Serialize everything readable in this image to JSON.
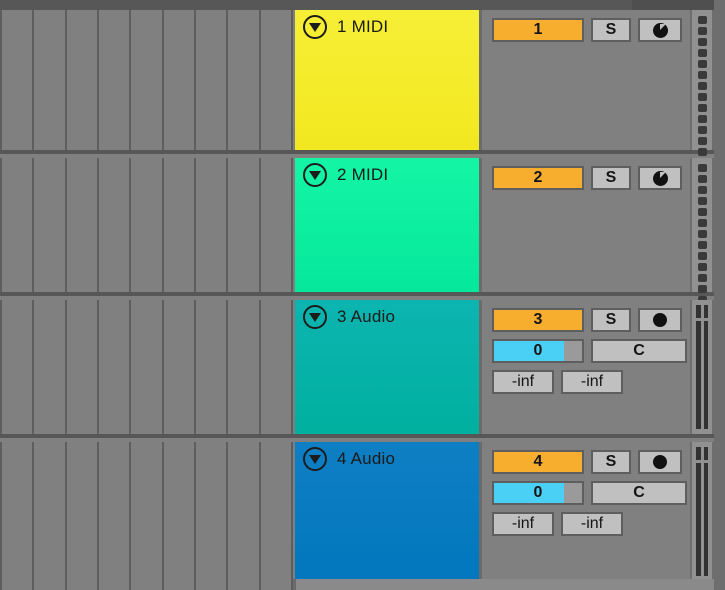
{
  "app": {
    "view": "session-view",
    "grid_columns": 9
  },
  "colors": {
    "background": "#808080",
    "divider": "#575757",
    "accent_orange": "#f7ad2e",
    "accent_cyan": "#4ad0f5",
    "button_face": "#c0c0c0",
    "text_dark": "#141414"
  },
  "tracks": [
    {
      "index": "1",
      "name": "1 MIDI",
      "type": "midi",
      "color_top": "#f7ef36",
      "color_bottom": "#f2e820",
      "disclosure_icon": "triangle-down-icon",
      "controls": {
        "track_number_label": "1",
        "solo_label": "S",
        "arm_icon": "midi-record-arm-icon",
        "arm_label": ""
      },
      "meter": {
        "style": "dots",
        "dot_count": 15
      }
    },
    {
      "index": "2",
      "name": "2 MIDI",
      "type": "midi",
      "color_top": "#15f5a6",
      "color_bottom": "#05e79b",
      "disclosure_icon": "triangle-down-icon",
      "controls": {
        "track_number_label": "2",
        "solo_label": "S",
        "arm_icon": "midi-record-arm-icon",
        "arm_label": ""
      },
      "meter": {
        "style": "dots",
        "dot_count": 15
      }
    },
    {
      "index": "3",
      "name": "3 Audio",
      "type": "audio",
      "color_top": "#0cb5b0",
      "color_bottom": "#01b09f",
      "disclosure_icon": "triangle-down-icon",
      "controls": {
        "track_number_label": "3",
        "solo_label": "S",
        "arm_icon": "audio-record-arm-icon",
        "volume_value": "0",
        "volume_fill_percent": 80,
        "pan_label": "C",
        "meter_left_label": "-inf",
        "meter_right_label": "-inf"
      },
      "meter": {
        "style": "bars",
        "bar_count": 2
      }
    },
    {
      "index": "4",
      "name": "4 Audio",
      "type": "audio",
      "color_top": "#0f7fc4",
      "color_bottom": "#0277bd",
      "disclosure_icon": "triangle-down-icon",
      "controls": {
        "track_number_label": "4",
        "solo_label": "S",
        "arm_icon": "audio-record-arm-icon",
        "volume_value": "0",
        "volume_fill_percent": 80,
        "pan_label": "C",
        "meter_left_label": "-inf",
        "meter_right_label": "-inf"
      },
      "meter": {
        "style": "bars",
        "bar_count": 2
      }
    }
  ]
}
